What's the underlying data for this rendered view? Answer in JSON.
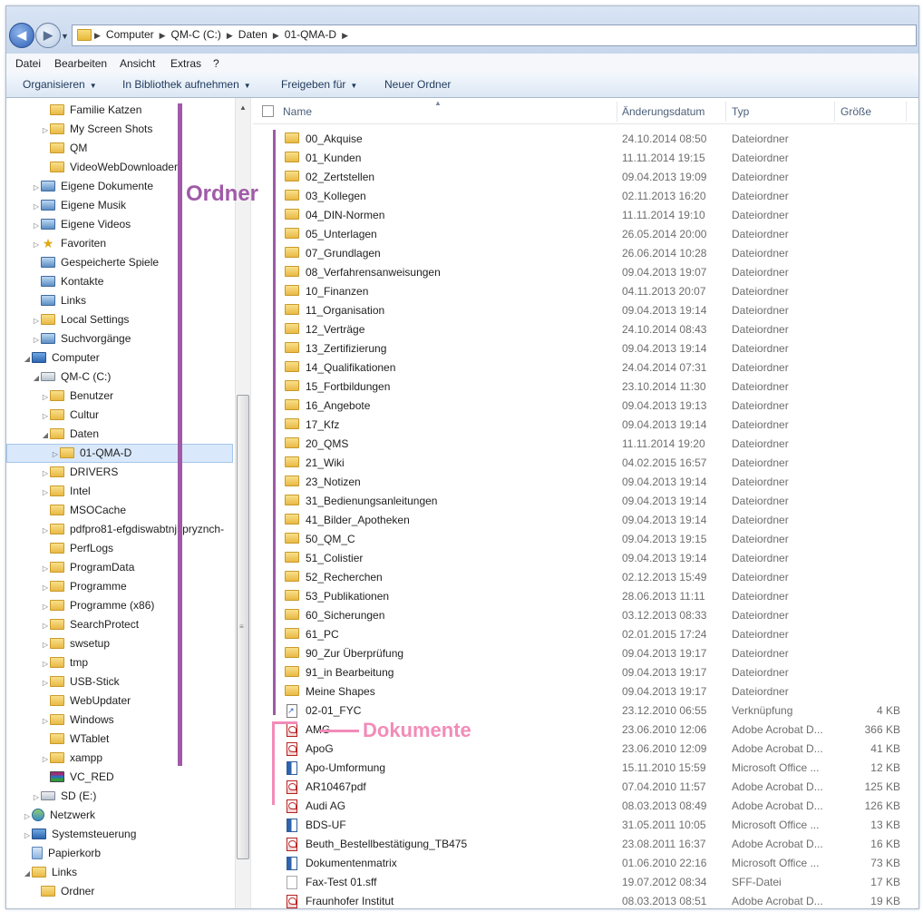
{
  "address": {
    "crumbs": [
      "Computer",
      "QM-C (C:)",
      "Daten",
      "01-QMA-D"
    ]
  },
  "menu": [
    "Datei",
    "Bearbeiten",
    "Ansicht",
    "Extras",
    "?"
  ],
  "toolbar": {
    "organize": "Organisieren",
    "library": "In Bibliothek aufnehmen",
    "share": "Freigeben für",
    "newfolder": "Neuer Ordner"
  },
  "nav": [
    {
      "label": "Familie Katzen",
      "icon": "folder-icon",
      "level": 3,
      "exp": ""
    },
    {
      "label": "My Screen Shots",
      "icon": "folder-icon",
      "level": 3,
      "exp": "▷"
    },
    {
      "label": "QM",
      "icon": "folder-icon",
      "level": 3,
      "exp": ""
    },
    {
      "label": "VideoWebDownloader",
      "icon": "folder-icon",
      "level": 3,
      "exp": ""
    },
    {
      "label": "Eigene Dokumente",
      "icon": "special-folder-icon",
      "level": 2,
      "exp": "▷"
    },
    {
      "label": "Eigene Musik",
      "icon": "special-folder-icon",
      "level": 2,
      "exp": "▷"
    },
    {
      "label": "Eigene Videos",
      "icon": "special-folder-icon",
      "level": 2,
      "exp": "▷"
    },
    {
      "label": "Favoriten",
      "icon": "favorites-star-icon",
      "level": 2,
      "exp": "▷"
    },
    {
      "label": "Gespeicherte Spiele",
      "icon": "special-folder-icon",
      "level": 2,
      "exp": ""
    },
    {
      "label": "Kontakte",
      "icon": "special-folder-icon",
      "level": 2,
      "exp": ""
    },
    {
      "label": "Links",
      "icon": "special-folder-icon",
      "level": 2,
      "exp": ""
    },
    {
      "label": "Local Settings",
      "icon": "folder-icon",
      "level": 2,
      "exp": "▷"
    },
    {
      "label": "Suchvorgänge",
      "icon": "special-folder-icon",
      "level": 2,
      "exp": "▷"
    },
    {
      "label": "Computer",
      "icon": "computer-icon",
      "level": 1,
      "exp": "◢"
    },
    {
      "label": "QM-C (C:)",
      "icon": "drive-icon",
      "level": 2,
      "exp": "◢"
    },
    {
      "label": "Benutzer",
      "icon": "folder-icon",
      "level": 3,
      "exp": "▷"
    },
    {
      "label": "Cultur",
      "icon": "folder-icon",
      "level": 3,
      "exp": "▷"
    },
    {
      "label": "Daten",
      "icon": "folder-icon",
      "level": 3,
      "exp": "◢"
    },
    {
      "label": "01-QMA-D",
      "icon": "folder-icon",
      "level": 4,
      "exp": "▷",
      "selected": true
    },
    {
      "label": "DRIVERS",
      "icon": "folder-icon",
      "level": 3,
      "exp": "▷"
    },
    {
      "label": "Intel",
      "icon": "folder-icon",
      "level": 3,
      "exp": "▷"
    },
    {
      "label": "MSOCache",
      "icon": "folder-icon",
      "level": 3,
      "exp": ""
    },
    {
      "label": "pdfpro81-efgdiswabtnjkpryznch-",
      "icon": "folder-icon",
      "level": 3,
      "exp": "▷"
    },
    {
      "label": "PerfLogs",
      "icon": "folder-icon",
      "level": 3,
      "exp": ""
    },
    {
      "label": "ProgramData",
      "icon": "folder-icon",
      "level": 3,
      "exp": "▷"
    },
    {
      "label": "Programme",
      "icon": "folder-icon",
      "level": 3,
      "exp": "▷"
    },
    {
      "label": "Programme (x86)",
      "icon": "folder-icon",
      "level": 3,
      "exp": "▷"
    },
    {
      "label": "SearchProtect",
      "icon": "folder-icon",
      "level": 3,
      "exp": "▷"
    },
    {
      "label": "swsetup",
      "icon": "folder-icon",
      "level": 3,
      "exp": "▷"
    },
    {
      "label": "tmp",
      "icon": "folder-icon",
      "level": 3,
      "exp": "▷"
    },
    {
      "label": "USB-Stick",
      "icon": "folder-icon",
      "level": 3,
      "exp": "▷"
    },
    {
      "label": "WebUpdater",
      "icon": "folder-icon",
      "level": 3,
      "exp": ""
    },
    {
      "label": "Windows",
      "icon": "folder-icon",
      "level": 3,
      "exp": "▷"
    },
    {
      "label": "WTablet",
      "icon": "folder-icon",
      "level": 3,
      "exp": ""
    },
    {
      "label": "xampp",
      "icon": "folder-icon",
      "level": 3,
      "exp": "▷"
    },
    {
      "label": "VC_RED",
      "icon": "winrar-icon",
      "level": 3,
      "exp": ""
    },
    {
      "label": "SD (E:)",
      "icon": "drive-icon",
      "level": 2,
      "exp": "▷"
    },
    {
      "label": "Netzwerk",
      "icon": "network-icon",
      "level": 1,
      "exp": "▷"
    },
    {
      "label": "Systemsteuerung",
      "icon": "control-panel-icon",
      "level": 1,
      "exp": "▷"
    },
    {
      "label": "Papierkorb",
      "icon": "recycle-bin-icon",
      "level": 1,
      "exp": ""
    },
    {
      "label": "Links",
      "icon": "folder-icon",
      "level": 1,
      "exp": "◢"
    },
    {
      "label": "Ordner",
      "icon": "folder-icon",
      "level": 2,
      "exp": ""
    }
  ],
  "columns": {
    "name": "Name",
    "date": "Änderungsdatum",
    "type": "Typ",
    "size": "Größe"
  },
  "files": [
    {
      "name": "00_Akquise",
      "date": "24.10.2014 08:50",
      "type": "Dateiordner",
      "size": "",
      "icon": "folder"
    },
    {
      "name": "01_Kunden",
      "date": "11.11.2014 19:15",
      "type": "Dateiordner",
      "size": "",
      "icon": "folder"
    },
    {
      "name": "02_Zertstellen",
      "date": "09.04.2013 19:09",
      "type": "Dateiordner",
      "size": "",
      "icon": "folder"
    },
    {
      "name": "03_Kollegen",
      "date": "02.11.2013 16:20",
      "type": "Dateiordner",
      "size": "",
      "icon": "folder"
    },
    {
      "name": "04_DIN-Normen",
      "date": "11.11.2014 19:10",
      "type": "Dateiordner",
      "size": "",
      "icon": "folder"
    },
    {
      "name": "05_Unterlagen",
      "date": "26.05.2014 20:00",
      "type": "Dateiordner",
      "size": "",
      "icon": "folder"
    },
    {
      "name": "07_Grundlagen",
      "date": "26.06.2014 10:28",
      "type": "Dateiordner",
      "size": "",
      "icon": "folder"
    },
    {
      "name": "08_Verfahrensanweisungen",
      "date": "09.04.2013 19:07",
      "type": "Dateiordner",
      "size": "",
      "icon": "folder"
    },
    {
      "name": "10_Finanzen",
      "date": "04.11.2013 20:07",
      "type": "Dateiordner",
      "size": "",
      "icon": "folder"
    },
    {
      "name": "11_Organisation",
      "date": "09.04.2013 19:14",
      "type": "Dateiordner",
      "size": "",
      "icon": "folder"
    },
    {
      "name": "12_Verträge",
      "date": "24.10.2014 08:43",
      "type": "Dateiordner",
      "size": "",
      "icon": "folder"
    },
    {
      "name": "13_Zertifizierung",
      "date": "09.04.2013 19:14",
      "type": "Dateiordner",
      "size": "",
      "icon": "folder"
    },
    {
      "name": "14_Qualifikationen",
      "date": "24.04.2014 07:31",
      "type": "Dateiordner",
      "size": "",
      "icon": "folder"
    },
    {
      "name": "15_Fortbildungen",
      "date": "23.10.2014 11:30",
      "type": "Dateiordner",
      "size": "",
      "icon": "folder"
    },
    {
      "name": "16_Angebote",
      "date": "09.04.2013 19:13",
      "type": "Dateiordner",
      "size": "",
      "icon": "folder"
    },
    {
      "name": "17_Kfz",
      "date": "09.04.2013 19:14",
      "type": "Dateiordner",
      "size": "",
      "icon": "folder"
    },
    {
      "name": "20_QMS",
      "date": "11.11.2014 19:20",
      "type": "Dateiordner",
      "size": "",
      "icon": "folder"
    },
    {
      "name": "21_Wiki",
      "date": "04.02.2015 16:57",
      "type": "Dateiordner",
      "size": "",
      "icon": "folder"
    },
    {
      "name": "23_Notizen",
      "date": "09.04.2013 19:14",
      "type": "Dateiordner",
      "size": "",
      "icon": "folder"
    },
    {
      "name": "31_Bedienungsanleitungen",
      "date": "09.04.2013 19:14",
      "type": "Dateiordner",
      "size": "",
      "icon": "folder"
    },
    {
      "name": "41_Bilder_Apotheken",
      "date": "09.04.2013 19:14",
      "type": "Dateiordner",
      "size": "",
      "icon": "folder"
    },
    {
      "name": "50_QM_C",
      "date": "09.04.2013 19:15",
      "type": "Dateiordner",
      "size": "",
      "icon": "folder"
    },
    {
      "name": "51_Colistier",
      "date": "09.04.2013 19:14",
      "type": "Dateiordner",
      "size": "",
      "icon": "folder"
    },
    {
      "name": "52_Recherchen",
      "date": "02.12.2013 15:49",
      "type": "Dateiordner",
      "size": "",
      "icon": "folder"
    },
    {
      "name": "53_Publikationen",
      "date": "28.06.2013 11:11",
      "type": "Dateiordner",
      "size": "",
      "icon": "folder"
    },
    {
      "name": "60_Sicherungen",
      "date": "03.12.2013 08:33",
      "type": "Dateiordner",
      "size": "",
      "icon": "folder"
    },
    {
      "name": "61_PC",
      "date": "02.01.2015 17:24",
      "type": "Dateiordner",
      "size": "",
      "icon": "folder"
    },
    {
      "name": "90_Zur Überprüfung",
      "date": "09.04.2013 19:17",
      "type": "Dateiordner",
      "size": "",
      "icon": "folder"
    },
    {
      "name": "91_in Bearbeitung",
      "date": "09.04.2013 19:17",
      "type": "Dateiordner",
      "size": "",
      "icon": "folder"
    },
    {
      "name": "Meine Shapes",
      "date": "09.04.2013 19:17",
      "type": "Dateiordner",
      "size": "",
      "icon": "folder"
    },
    {
      "name": "02-01_FYC",
      "date": "23.12.2010 06:55",
      "type": "Verknüpfung",
      "size": "4 KB",
      "icon": "shortcut"
    },
    {
      "name": "AMG",
      "date": "23.06.2010 12:06",
      "type": "Adobe Acrobat D...",
      "size": "366 KB",
      "icon": "pdf"
    },
    {
      "name": "ApoG",
      "date": "23.06.2010 12:09",
      "type": "Adobe Acrobat D...",
      "size": "41 KB",
      "icon": "pdf"
    },
    {
      "name": "Apo-Umformung",
      "date": "15.11.2010 15:59",
      "type": "Microsoft Office ...",
      "size": "12 KB",
      "icon": "doc"
    },
    {
      "name": "AR10467pdf",
      "date": "07.04.2010 11:57",
      "type": "Adobe Acrobat D...",
      "size": "125 KB",
      "icon": "pdf"
    },
    {
      "name": "Audi AG",
      "date": "08.03.2013 08:49",
      "type": "Adobe Acrobat D...",
      "size": "126 KB",
      "icon": "pdf"
    },
    {
      "name": "BDS-UF",
      "date": "31.05.2011 10:05",
      "type": "Microsoft Office ...",
      "size": "13 KB",
      "icon": "doc"
    },
    {
      "name": "Beuth_Bestellbestätigung_TB475",
      "date": "23.08.2011 16:37",
      "type": "Adobe Acrobat D...",
      "size": "16 KB",
      "icon": "pdf"
    },
    {
      "name": "Dokumentenmatrix",
      "date": "01.06.2010 22:16",
      "type": "Microsoft Office ...",
      "size": "73 KB",
      "icon": "doc"
    },
    {
      "name": "Fax-Test 01.sff",
      "date": "19.07.2012 08:34",
      "type": "SFF-Datei",
      "size": "17 KB",
      "icon": "sff"
    },
    {
      "name": "Fraunhofer Institut",
      "date": "08.03.2013 08:51",
      "type": "Adobe Acrobat D...",
      "size": "19 KB",
      "icon": "pdf"
    }
  ],
  "annotations": {
    "ordner": {
      "text": "Ordner",
      "color": "#a05aa8"
    },
    "dokumente": {
      "text": "Dokumente",
      "color": "#f28cb8"
    }
  }
}
